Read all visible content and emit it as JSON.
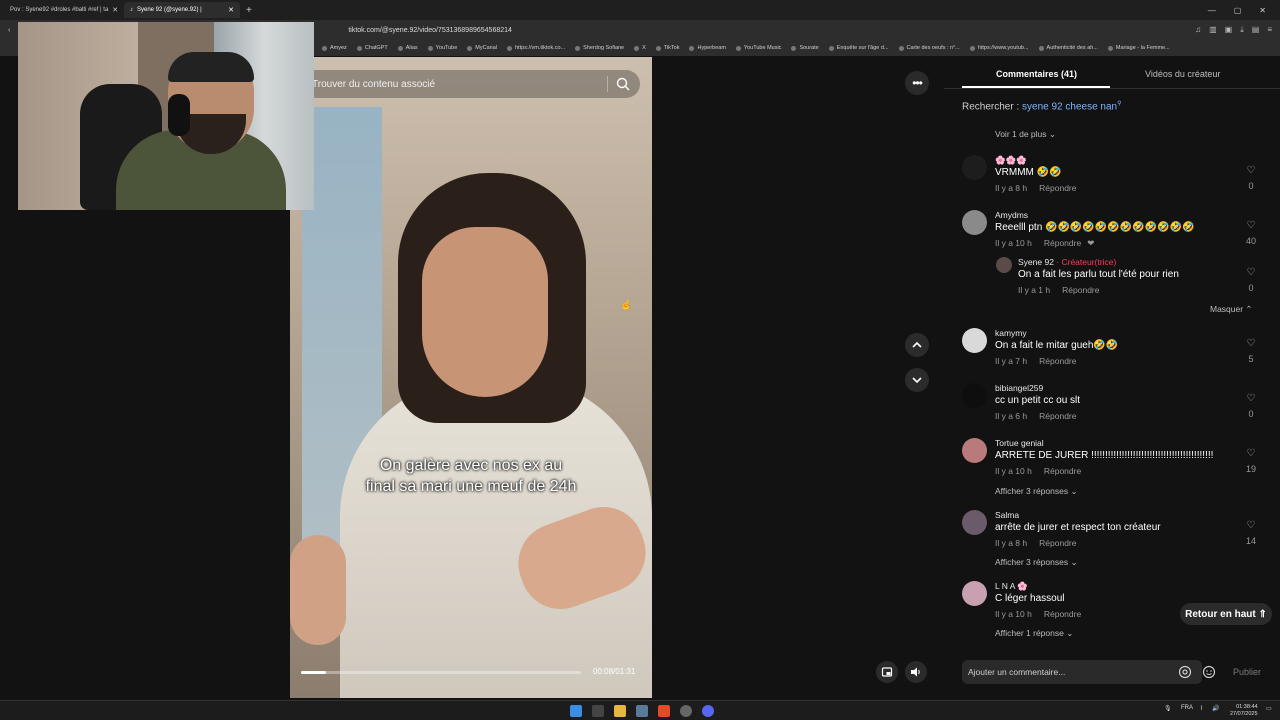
{
  "browser": {
    "tabs": [
      {
        "label": "Pov : Syene92 #droles #balti #ref | ta"
      },
      {
        "label": "Syene 92 (@syene.92) |"
      }
    ],
    "url": "tiktok.com/@syene.92/video/7531368989654568214",
    "bookmarks": [
      "Amyez",
      "ChatGPT",
      "Alias",
      "YouTube",
      "MyCanal",
      "https://vm.tiktok.co...",
      "Sherdog Sofiane",
      "X",
      "TikTok",
      "Hyperbeam",
      "YouTube Music",
      "Sourate",
      "Enquête sur l'âge d...",
      "Carte des oeufs : n°...",
      "https://www.youtub...",
      "Authenticité des ah...",
      "Mariage - la Femme..."
    ]
  },
  "video": {
    "search_placeholder": "Trouver du contenu associé",
    "caption_line1": "On galère avec nos ex au",
    "caption_line2": "final sa mari une meuf de 24h",
    "current_time": "00:08/01:31",
    "progress_fraction": 0.088
  },
  "panel": {
    "tab_comments": "Commentaires (41)",
    "tab_videos": "Vidéos du créateur",
    "related_prefix": "Rechercher : ",
    "related_query": "syene 92 cheese nan",
    "view_more": "Voir 1 de plus ⌄",
    "reply_label": "Répondre",
    "hide_label": "Masquer ⌃",
    "comments": [
      {
        "name": "🌸🌸🌸",
        "text": "VRMMM 🤣🤣",
        "time": "Il y a 8 h",
        "likes": "0"
      },
      {
        "name": "Amydms",
        "text": "Reeelll ptn 🤣🤣🤣🤣🤣🤣🤣🤣🤣🤣🤣🤣",
        "time": "Il y a 10 h",
        "likes": "40"
      },
      {
        "name": "kamymy",
        "text": "On a fait le mitar gueh🤣🤣",
        "time": "Il y a 7 h",
        "likes": "5"
      },
      {
        "name": "bibiangel259",
        "text": "cc un petit cc ou slt",
        "time": "Il y a 6 h",
        "likes": "0"
      },
      {
        "name": "Tortue genial",
        "text": "ARRETE DE JURER !!!!!!!!!!!!!!!!!!!!!!!!!!!!!!!!!!!!!!!!!!!!",
        "time": "Il y a 10 h",
        "likes": "19",
        "replies": "Afficher 3 réponses ⌄"
      },
      {
        "name": "Salma",
        "text": "arrête de jurer et respect ton créateur",
        "time": "Il y a 8 h",
        "likes": "14",
        "replies": "Afficher 3 réponses ⌄"
      },
      {
        "name": "L N A 🌸",
        "text": "C léger hassoul",
        "time": "Il y a 10 h",
        "likes": "",
        "replies": "Afficher 1 réponse ⌄"
      }
    ],
    "creator_reply": {
      "name": "Syene 92",
      "badge": "· Créateur(trice)",
      "text": "On a fait les parlu tout l'été pour rien",
      "time": "Il y a 1 h",
      "likes": "0"
    },
    "back_to_top": "Retour en haut ⇑",
    "compose_placeholder": "Ajouter un commentaire...",
    "publish": "Publier"
  },
  "taskbar": {
    "lang": "FRA",
    "time": "01:38:44",
    "date": "27/07/2025"
  },
  "colors": {
    "accent_link": "#7fb6ff",
    "creator": "#ff3b5c"
  }
}
